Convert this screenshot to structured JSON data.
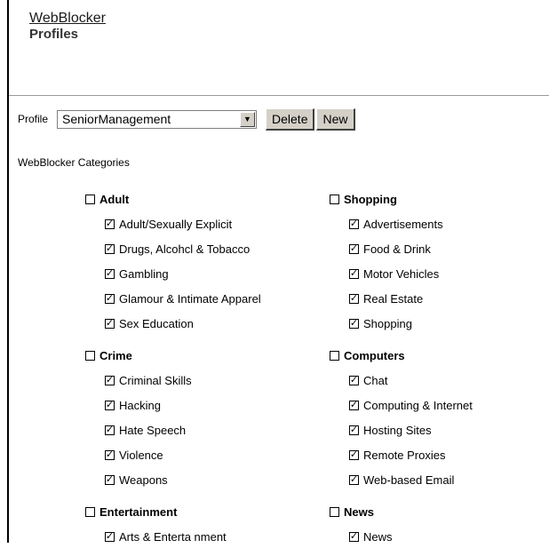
{
  "header": {
    "app_link": "WebBlocker",
    "title": "Profiles"
  },
  "profile": {
    "label": "Profile",
    "selected": "SeniorManagement",
    "delete_label": "Delete",
    "new_label": "New"
  },
  "categories_title": "WebBlocker Categories",
  "left_groups": [
    {
      "name": "Adult",
      "checked": false,
      "items": [
        {
          "label": "Adult/Sexually Explicit",
          "checked": true
        },
        {
          "label": "Drugs, Alcohcl & Tobacco",
          "checked": true
        },
        {
          "label": "Gambling",
          "checked": true
        },
        {
          "label": "Glamour & Intimate Apparel",
          "checked": true
        },
        {
          "label": "Sex Education",
          "checked": true
        }
      ]
    },
    {
      "name": "Crime",
      "checked": false,
      "items": [
        {
          "label": "Criminal Skills",
          "checked": true
        },
        {
          "label": "Hacking",
          "checked": true
        },
        {
          "label": "Hate Speech",
          "checked": true
        },
        {
          "label": "Violence",
          "checked": true
        },
        {
          "label": "Weapons",
          "checked": true
        }
      ]
    },
    {
      "name": "Entertainment",
      "checked": false,
      "items": [
        {
          "label": "Arts & Enterta nment",
          "checked": true
        }
      ]
    }
  ],
  "right_groups": [
    {
      "name": "Shopping",
      "checked": false,
      "items": [
        {
          "label": "Advertisements",
          "checked": true
        },
        {
          "label": "Food & Drink",
          "checked": true
        },
        {
          "label": "Motor Vehicles",
          "checked": true
        },
        {
          "label": "Real Estate",
          "checked": true
        },
        {
          "label": "Shopping",
          "checked": true
        }
      ]
    },
    {
      "name": "Computers",
      "checked": false,
      "items": [
        {
          "label": "Chat",
          "checked": true
        },
        {
          "label": "Computing & Internet",
          "checked": true
        },
        {
          "label": "Hosting Sites",
          "checked": true
        },
        {
          "label": "Remote Proxies",
          "checked": true
        },
        {
          "label": "Web-based Email",
          "checked": true
        }
      ]
    },
    {
      "name": "News",
      "checked": false,
      "items": [
        {
          "label": "News",
          "checked": true
        }
      ]
    }
  ]
}
